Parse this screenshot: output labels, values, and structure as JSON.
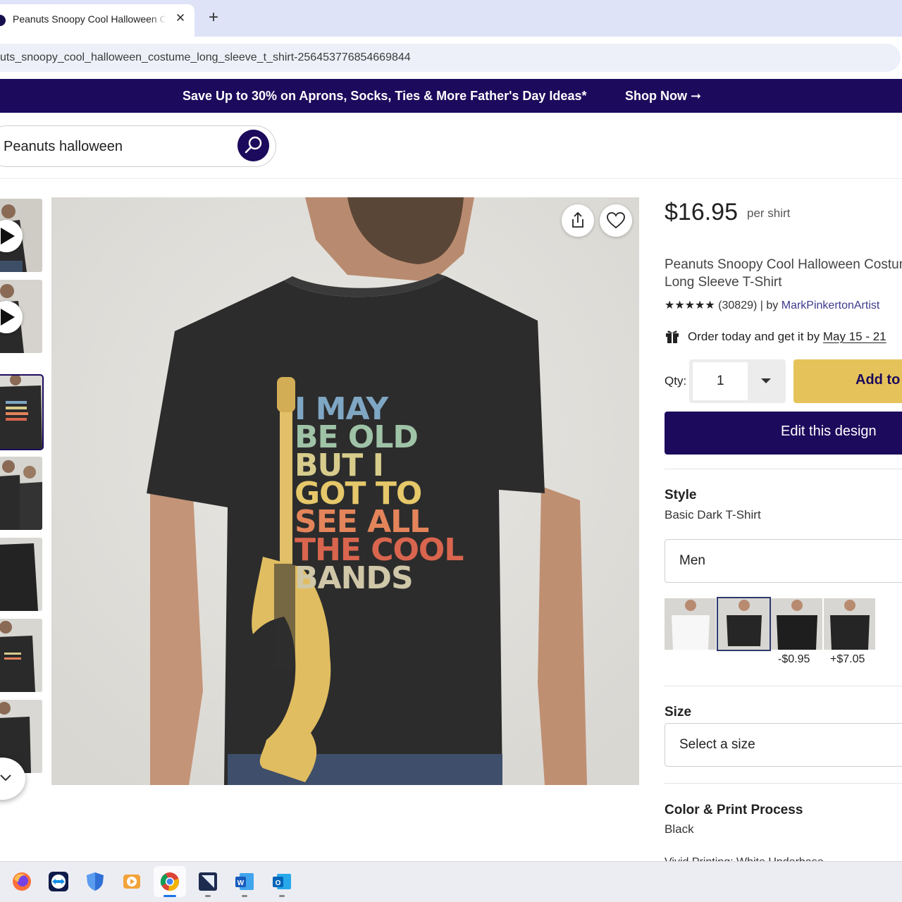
{
  "browser": {
    "tab_title": "Peanuts Snoopy Cool Halloween Costume Long Sleeve T-Shirt",
    "tab_close": "✕",
    "new_tab": "+",
    "url": "uts_snoopy_cool_halloween_costume_long_sleeve_t_shirt-256453776854669844"
  },
  "promo": {
    "text": "Save Up to 30% on Aprons, Socks, Ties & More Father's Day Ideas*",
    "shop_label": "Shop Now ➞"
  },
  "search": {
    "value": "Peanuts halloween"
  },
  "gallery": {
    "thumbnails": [
      "video",
      "video",
      "image",
      "image",
      "image",
      "image",
      "image"
    ],
    "selected_index": 2,
    "print_lines": [
      "I MAY",
      "BE OLD",
      "BUT I",
      "GOT TO",
      "SEE ALL",
      "THE COOL",
      "BANDS"
    ],
    "print_colors": [
      "#7fa7c4",
      "#9fc3a6",
      "#d8cc8c",
      "#e6c86a",
      "#e4845a",
      "#d9654e",
      "#cfc7a8"
    ]
  },
  "product": {
    "price": "$16.95",
    "price_unit": "per shirt",
    "title": "Peanuts Snoopy Cool Halloween Costume Long Sleeve T-Shirt",
    "stars": "★★★★★",
    "review_count": "(30829)",
    "by_label": "| by",
    "seller": "MarkPinkertonArtist",
    "delivery_prefix": "Order today and get it by",
    "delivery_dates": "May 15 - 21",
    "qty_label": "Qty:",
    "qty_value": "1",
    "add_label": "Add to Cart",
    "edit_label": "Edit this design"
  },
  "style": {
    "title": "Style",
    "value": "Basic Dark T-Shirt",
    "dropdown": "Men",
    "swatch_prices": [
      "",
      "",
      "-$0.95",
      "+$7.05"
    ]
  },
  "size": {
    "title": "Size",
    "placeholder": "Select a size"
  },
  "color": {
    "title": "Color & Print Process",
    "value": "Black",
    "next_line": "Vivid Printing: White Underbase"
  },
  "colors": {
    "brand": "#1c0a5c",
    "add_to_cart": "#e6c35a"
  },
  "taskbar": [
    "firefox-icon",
    "teamviewer-icon",
    "defender-icon",
    "media-player-icon",
    "chrome-icon",
    "app-icon",
    "word-icon",
    "outlook-icon"
  ]
}
